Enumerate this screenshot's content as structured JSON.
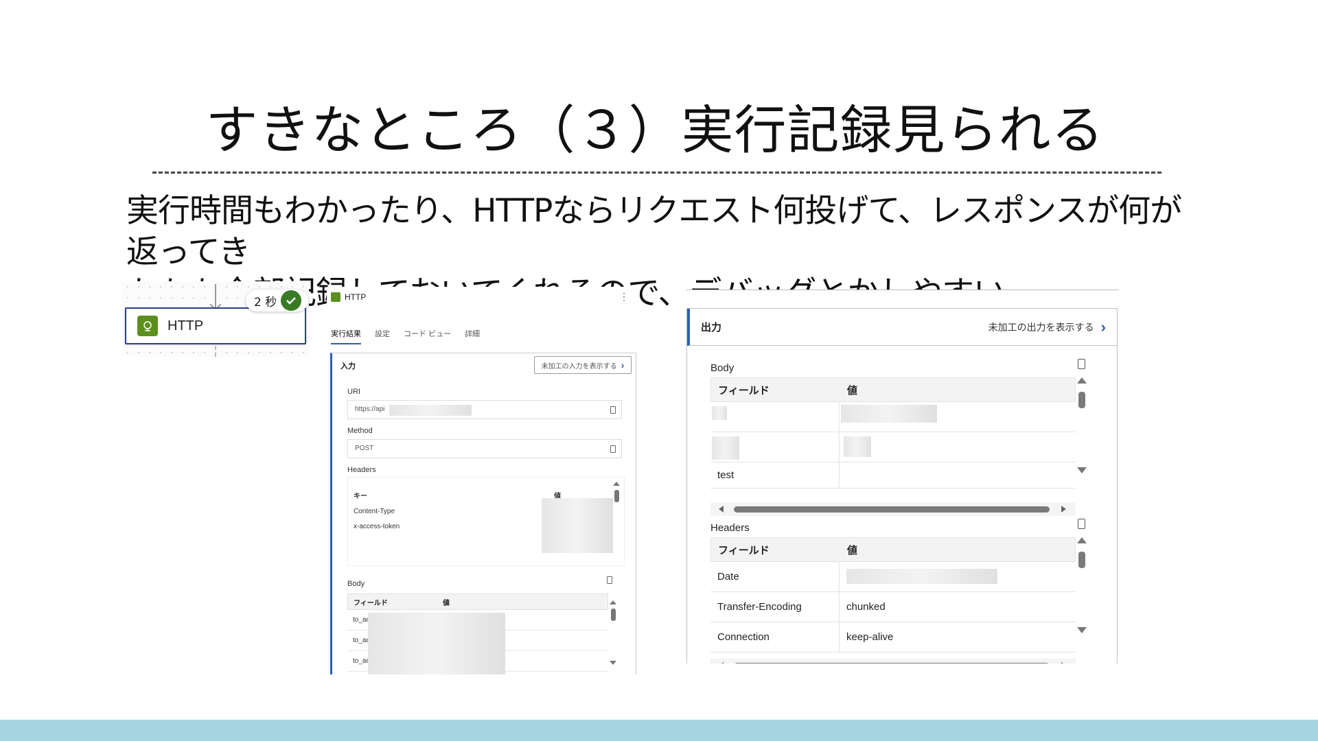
{
  "slide": {
    "title": "すきなところ（３）実行記録見られる",
    "body_line1": "実行時間もわかったり、HTTPならリクエスト何投げて、レスポンスが何が返ってき",
    "body_line2": "たかも全部記録しておいてくれるので、デバッグとかしやすい。"
  },
  "flow_node": {
    "label": "HTTP",
    "duration": "2 秒"
  },
  "run_panel": {
    "header": "HTTP",
    "more": "⋮",
    "tabs": [
      "実行結果",
      "設定",
      "コード ビュー",
      "詳細"
    ],
    "input_title": "入力",
    "show_raw_input": "未加工の入力を表示する",
    "uri_label": "URI",
    "uri_value": "https://api",
    "method_label": "Method",
    "method_value": "POST",
    "headers_label": "Headers",
    "headers_key_col": "キー",
    "headers_value_col": "値",
    "headers_rows": [
      "Content-Type",
      "x-access-token"
    ],
    "body_label": "Body",
    "body_field_col": "フィールド",
    "body_value_col": "値",
    "body_rows": [
      "to_ac",
      "to_ac",
      "to_ac"
    ]
  },
  "output_panel": {
    "title": "出力",
    "show_raw_output": "未加工の出力を表示する",
    "body_section": "Body",
    "body_field_col": "フィールド",
    "body_value_col": "値",
    "body_rows": [
      {
        "field": "",
        "value": ""
      },
      {
        "field": "",
        "value": ""
      },
      {
        "field": "test",
        "value": ""
      }
    ],
    "headers_section": "Headers",
    "headers_field_col": "フィールド",
    "headers_value_col": "値",
    "headers_rows": [
      {
        "field": "Date",
        "value": ""
      },
      {
        "field": "Transfer-Encoding",
        "value": "chunked"
      },
      {
        "field": "Connection",
        "value": "keep-alive"
      }
    ]
  },
  "colors": {
    "accent": "#2b5fb0",
    "node_border": "#2b3d8f",
    "http_icon": "#5b8f1e",
    "success": "#3a7a25",
    "footer_bar": "#a5d5e0"
  }
}
